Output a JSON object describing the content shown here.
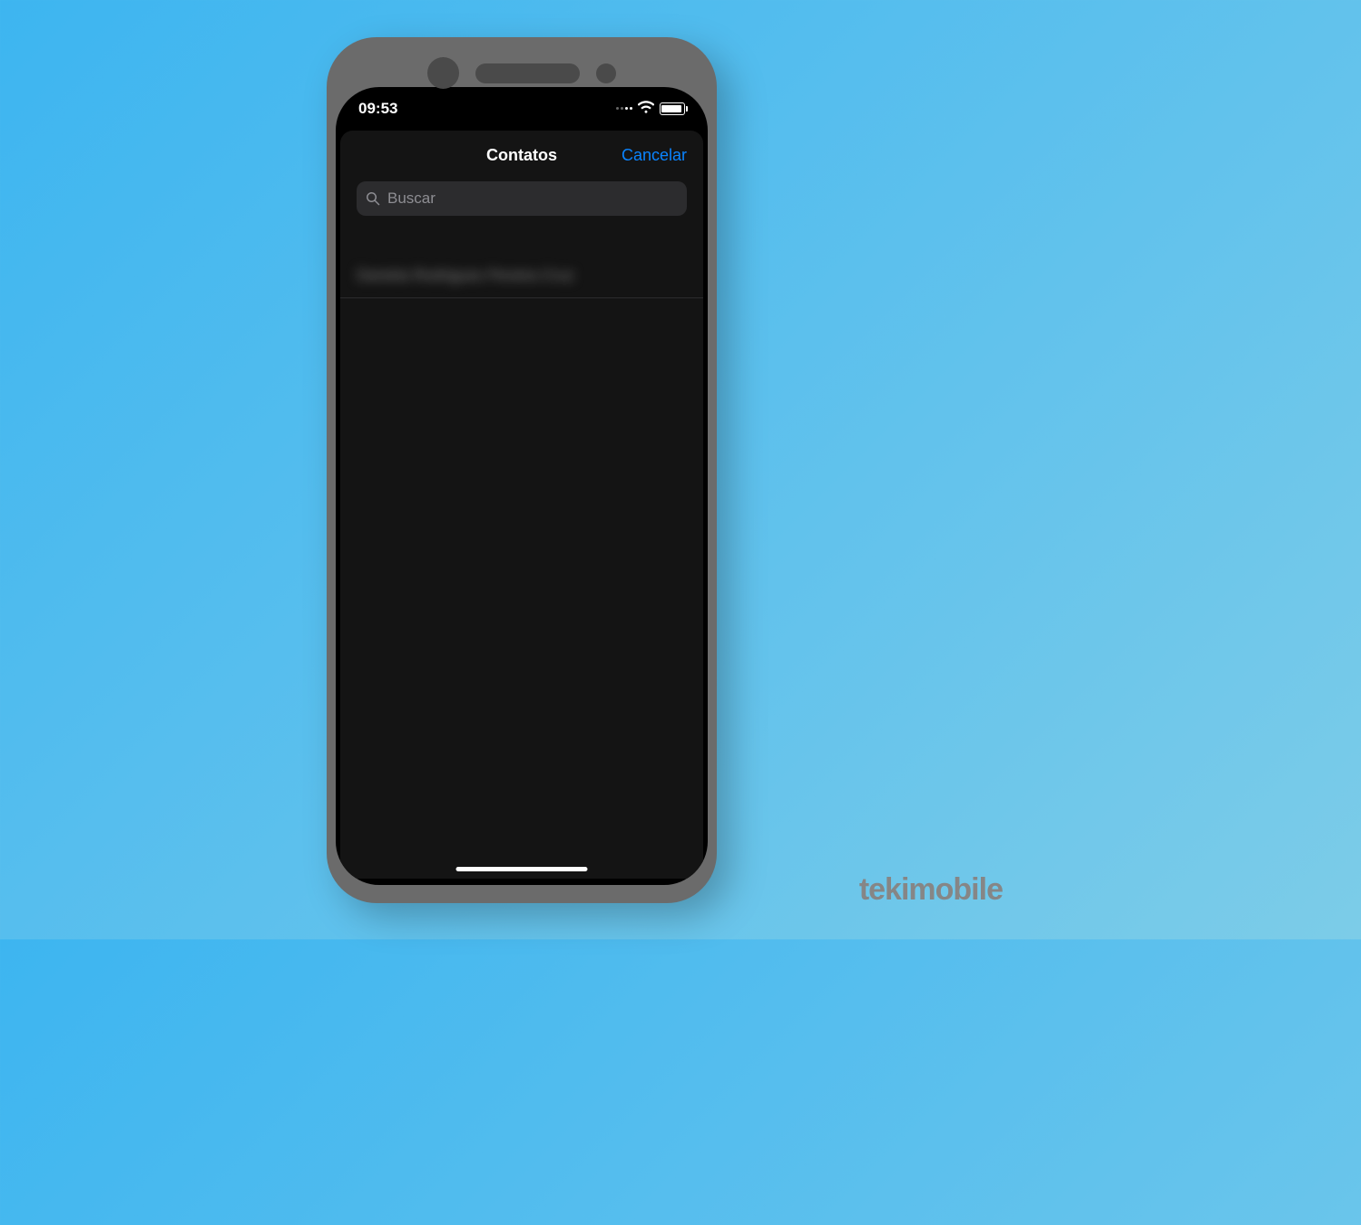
{
  "status_bar": {
    "time": "09:53"
  },
  "nav": {
    "title": "Contatos",
    "cancel": "Cancelar"
  },
  "search": {
    "placeholder": "Buscar",
    "value": ""
  },
  "contacts": [
    {
      "name": "Daniela Rodrigues Pereira Cruz"
    }
  ],
  "brand": "tekimobile"
}
